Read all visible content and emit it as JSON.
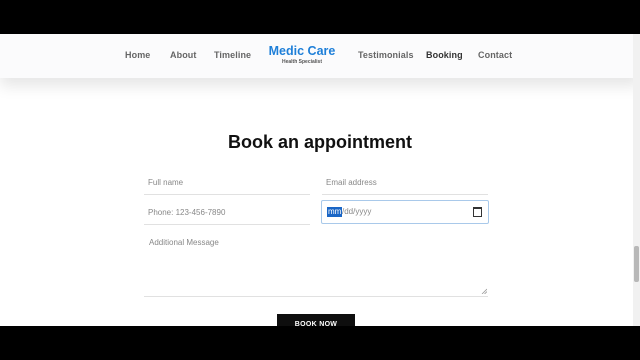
{
  "nav": {
    "items": [
      {
        "label": "Home"
      },
      {
        "label": "About"
      },
      {
        "label": "Timeline"
      },
      {
        "label": "Testimonials"
      },
      {
        "label": "Booking",
        "active": true
      },
      {
        "label": "Contact"
      }
    ],
    "brand": {
      "title": "Medic Care",
      "subtitle": "Health Specialist",
      "color": "#1e7fd8"
    }
  },
  "booking": {
    "heading": "Book an appointment",
    "fields": {
      "full_name": {
        "placeholder": "Full name"
      },
      "email": {
        "placeholder": "Email address"
      },
      "phone": {
        "placeholder": "Phone: 123-456-7890"
      },
      "date": {
        "selected_segment": "mm",
        "remaining": "/dd/yyyy",
        "icon": "calendar-icon"
      },
      "message": {
        "placeholder": "Additional Message"
      }
    },
    "submit_label": "BOOK NOW"
  },
  "colors": {
    "accent": "#1e7fd8",
    "selection": "#1a66c6",
    "button": "#0e0e0e"
  }
}
